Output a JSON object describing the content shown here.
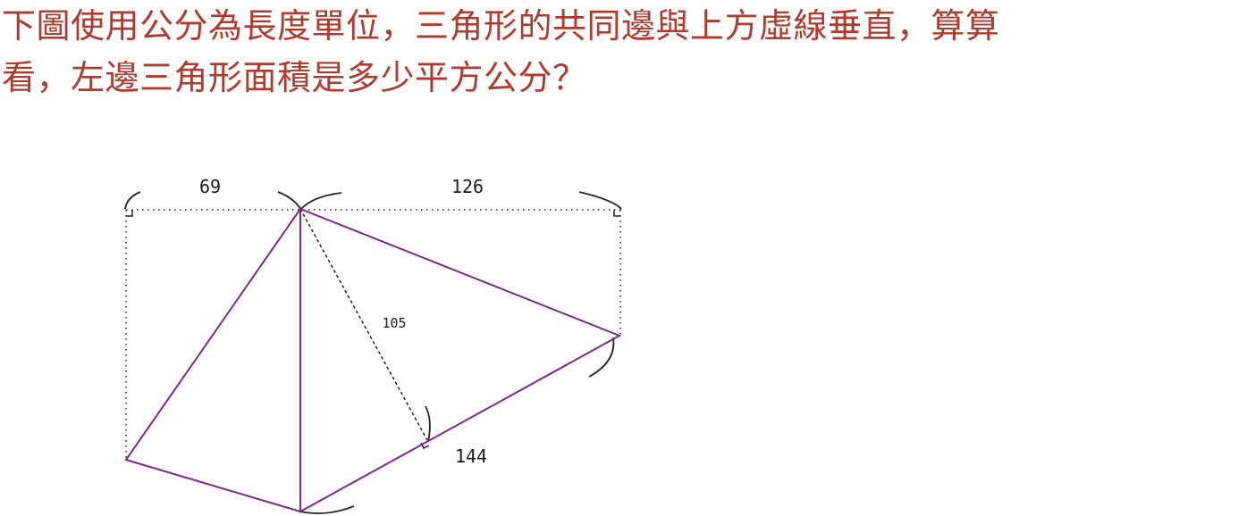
{
  "question": {
    "line1": "下圖使用公分為長度單位，三角形的共同邊與上方虛線垂直，算算",
    "line2": "看，左邊三角形面積是多少平方公分？"
  },
  "figure": {
    "labels": {
      "top_left_width": "69",
      "top_right_width": "126",
      "height": "105",
      "base": "144"
    },
    "colors": {
      "text": "#b03a2e",
      "triangle_edges": "#7b2a86",
      "guides": "#222222"
    }
  }
}
